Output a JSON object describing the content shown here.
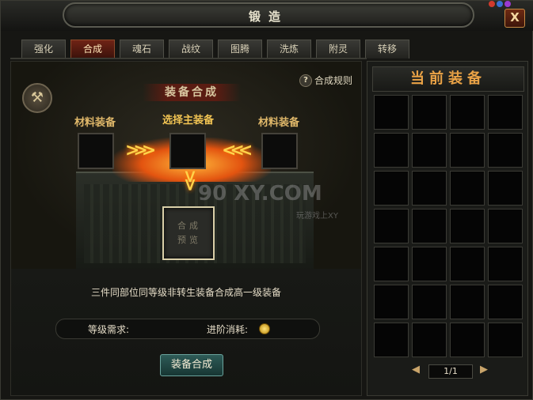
{
  "window": {
    "title": "锻造",
    "close_label": "X"
  },
  "tabs": [
    "强化",
    "合成",
    "魂石",
    "战纹",
    "图腾",
    "洗炼",
    "附灵",
    "转移"
  ],
  "active_tab": "合成",
  "synthesis": {
    "section_title": "装备合成",
    "help_icon": "?",
    "help_label": "合成规则",
    "material_label_left": "材料装备",
    "main_label": "选择主装备",
    "material_label_right": "材料装备",
    "result_placeholder": "合成预览",
    "watermark": "90 XY.COM",
    "watermark_sub": "玩游戏上XY",
    "description": "三件同部位同等级非转生装备合成高一级装备",
    "level_req_label": "等级需求:",
    "cost_label": "进阶消耗:",
    "action_label": "装备合成"
  },
  "inventory": {
    "title": "当前装备",
    "page": "1/1"
  },
  "icons": {
    "emblem": "hammer-icon",
    "help": "question-icon",
    "coin": "gold-coin-icon",
    "prev": "left-arrow-icon",
    "next": "right-arrow-icon"
  },
  "colors": {
    "accent_gold": "#f2c453",
    "active_tab": "#6f2315",
    "button_teal": "#2e5b57",
    "inventory_title": "#e9a246"
  }
}
